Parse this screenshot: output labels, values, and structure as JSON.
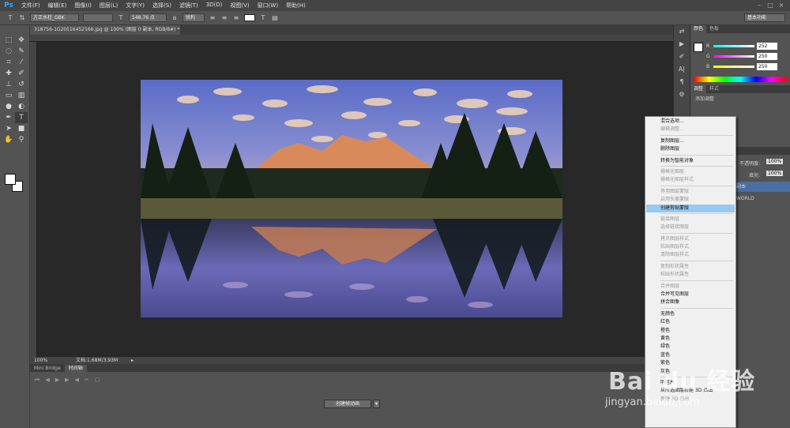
{
  "app": {
    "logo": "Ps"
  },
  "menu": [
    "文件(F)",
    "编辑(E)",
    "图像(I)",
    "图层(L)",
    "文字(Y)",
    "选择(S)",
    "滤镜(T)",
    "3D(D)",
    "视图(V)",
    "窗口(W)",
    "帮助(H)"
  ],
  "options": {
    "font_family": "方正水柱_GBK",
    "font_size": "148.76 点",
    "antialias": "锐利",
    "workspace": "基本功能"
  },
  "document": {
    "tab_title": "318756-1G20516452166.jpg @ 100% (图层 0 副本, RGB/8#) *",
    "zoom": "100%",
    "doc_size": "文档:1.68M/3.93M"
  },
  "timeline": {
    "tabs": [
      "Mini Bridge",
      "时间轴"
    ],
    "create_button": "创建帧动画"
  },
  "color_panel": {
    "tabs": [
      "颜色",
      "色板"
    ],
    "r": "252",
    "g": "250",
    "b": "250"
  },
  "adjust_panel": {
    "tabs": [
      "调整",
      "样式"
    ],
    "add_label": "添加调整"
  },
  "layers_panel": {
    "opacity_label": "不透明度:",
    "opacity": "100%",
    "fill_label": "填充:",
    "fill": "100%",
    "layer1": "副本",
    "layer2": "WORLD"
  },
  "context_menu": [
    {
      "label": "混合选项...",
      "state": "enabled"
    },
    {
      "label": "编辑调整...",
      "state": "disabled"
    },
    {
      "sep": true
    },
    {
      "label": "复制图层...",
      "state": "enabled"
    },
    {
      "label": "删除图层",
      "state": "enabled"
    },
    {
      "sep": true
    },
    {
      "label": "转换为智能对象",
      "state": "enabled"
    },
    {
      "sep": true
    },
    {
      "label": "栅格化图层",
      "state": "disabled"
    },
    {
      "label": "栅格化图层样式",
      "state": "disabled"
    },
    {
      "sep": true
    },
    {
      "label": "停用图层蒙版",
      "state": "disabled"
    },
    {
      "label": "启用矢量蒙版",
      "state": "disabled"
    },
    {
      "label": "创建剪贴蒙版",
      "state": "highlight"
    },
    {
      "sep": true
    },
    {
      "label": "链接图层",
      "state": "disabled"
    },
    {
      "label": "选择链接图层",
      "state": "disabled"
    },
    {
      "sep": true
    },
    {
      "label": "拷贝图层样式",
      "state": "disabled"
    },
    {
      "label": "粘贴图层样式",
      "state": "disabled"
    },
    {
      "label": "清除图层样式",
      "state": "disabled"
    },
    {
      "sep": true
    },
    {
      "label": "复制形状属性",
      "state": "disabled"
    },
    {
      "label": "粘贴形状属性",
      "state": "disabled"
    },
    {
      "sep": true
    },
    {
      "label": "合并图层",
      "state": "disabled"
    },
    {
      "label": "合并可见图层",
      "state": "enabled"
    },
    {
      "label": "拼合图像",
      "state": "enabled"
    },
    {
      "sep": true
    },
    {
      "label": "无颜色",
      "state": "enabled"
    },
    {
      "label": "红色",
      "state": "enabled"
    },
    {
      "label": "橙色",
      "state": "enabled"
    },
    {
      "label": "黄色",
      "state": "enabled"
    },
    {
      "label": "绿色",
      "state": "enabled"
    },
    {
      "label": "蓝色",
      "state": "enabled"
    },
    {
      "label": "紫色",
      "state": "enabled"
    },
    {
      "label": "灰色",
      "state": "enabled"
    },
    {
      "sep": true
    },
    {
      "label": "明信片",
      "state": "enabled"
    },
    {
      "label": "从所选图层新建 3D 凸出",
      "state": "enabled"
    },
    {
      "label": "新建 3D 凸出",
      "state": "disabled"
    }
  ],
  "watermark": {
    "brand": "Bai du 经验",
    "url": "jingyan.baidu.com"
  }
}
